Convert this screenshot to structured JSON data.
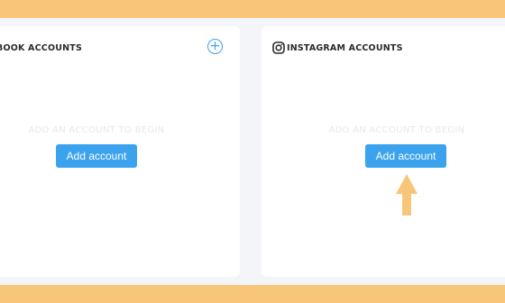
{
  "facebook_card": {
    "title": "BOOK ACCOUNTS",
    "add_icon": "plus-circle-icon",
    "empty_text": "ADD AN ACCOUNT TO BEGIN",
    "button_label": "Add account"
  },
  "instagram_card": {
    "title": "INSTAGRAM ACCOUNTS",
    "icon": "instagram-icon",
    "empty_text": "ADD AN ACCOUNT TO BEGIN",
    "button_label": "Add account"
  },
  "annotation": {
    "icon": "up-arrow-icon",
    "color": "#f8c679"
  },
  "colors": {
    "accent": "#3ba2ee",
    "band": "#f8c679",
    "background": "#f4f5f9"
  }
}
